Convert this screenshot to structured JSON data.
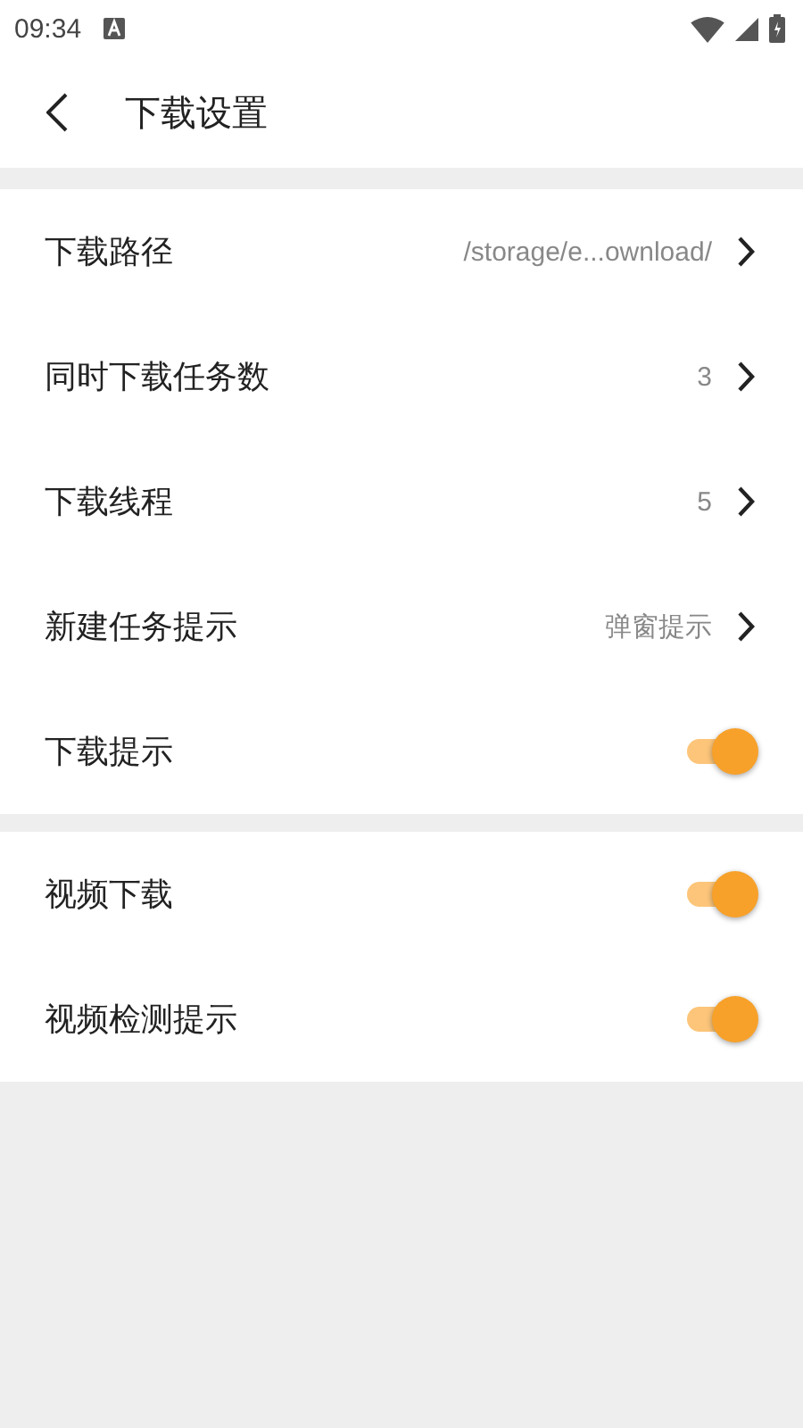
{
  "status_bar": {
    "time": "09:34"
  },
  "header": {
    "title": "下载设置"
  },
  "sections": [
    {
      "rows": [
        {
          "kind": "link",
          "label": "下载路径",
          "value": "/storage/e...ownload/"
        },
        {
          "kind": "link",
          "label": "同时下载任务数",
          "value": "3"
        },
        {
          "kind": "link",
          "label": "下载线程",
          "value": "5"
        },
        {
          "kind": "link",
          "label": "新建任务提示",
          "value": "弹窗提示"
        },
        {
          "kind": "toggle",
          "label": "下载提示",
          "on": true
        }
      ]
    },
    {
      "rows": [
        {
          "kind": "toggle",
          "label": "视频下载",
          "on": true
        },
        {
          "kind": "toggle",
          "label": "视频检测提示",
          "on": true
        }
      ]
    }
  ]
}
